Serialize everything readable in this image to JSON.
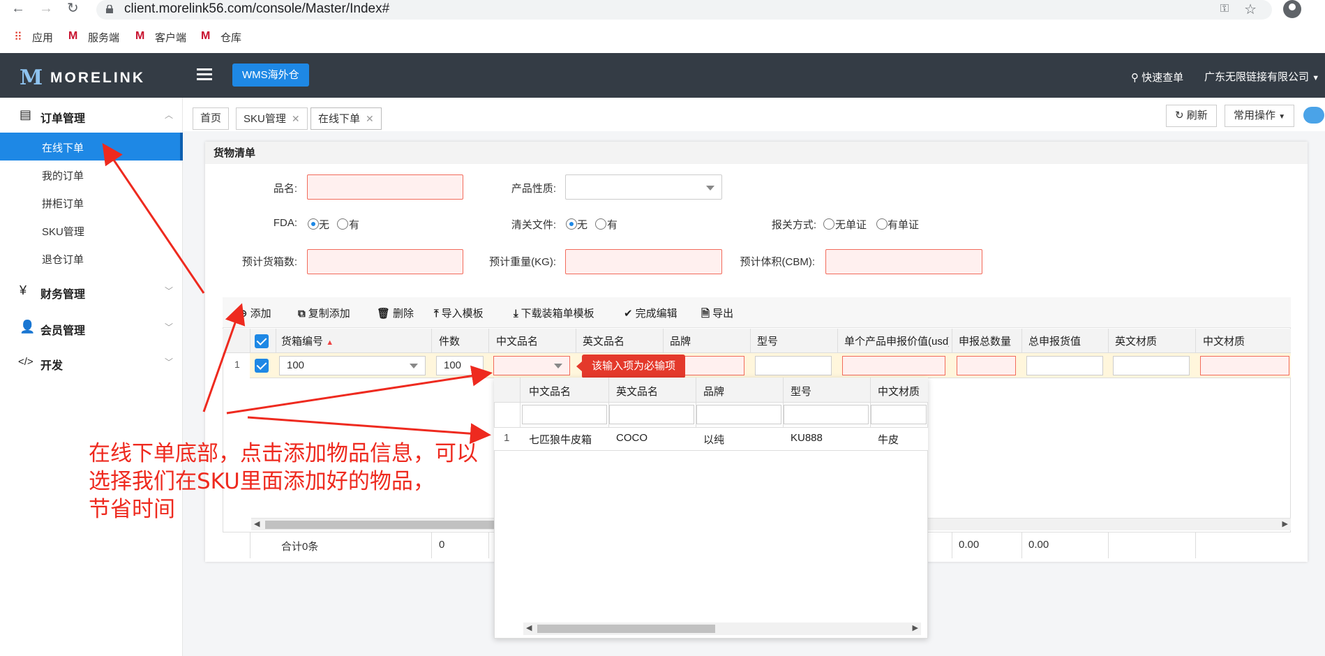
{
  "browser": {
    "url": "client.morelink56.com/console/Master/Index#",
    "bookmarks": {
      "apps": "应用",
      "server": "服务端",
      "client": "客户端",
      "warehouse": "仓库"
    }
  },
  "header": {
    "logo": "MORELINK",
    "logo_mark": "M",
    "wms_button": "WMS海外仓",
    "quick_search": "快速查单",
    "company": "广东无限链接有限公司"
  },
  "sidebar": {
    "groups": [
      {
        "label": "订单管理",
        "icon": "▤"
      },
      {
        "label": "财务管理",
        "icon": "¥"
      },
      {
        "label": "会员管理",
        "icon": "👤"
      },
      {
        "label": "开发",
        "icon": "</>"
      }
    ],
    "items": [
      "在线下单",
      "我的订单",
      "拼柜订单",
      "SKU管理",
      "退仓订单"
    ]
  },
  "tabs": [
    "首页",
    "SKU管理",
    "在线下单"
  ],
  "actions": {
    "refresh": "刷新",
    "common_ops": "常用操作"
  },
  "form": {
    "title": "货物清单",
    "name_label": "品名:",
    "nature_label": "产品性质:",
    "fda_label": "FDA:",
    "customs_docs_label": "清关文件:",
    "declare_label": "报关方式:",
    "opt_no": "无",
    "opt_yes": "有",
    "opt_no_doc": "无单证",
    "opt_has_doc": "有单证",
    "boxes_label": "预计货箱数:",
    "weight_label": "预计重量(KG):",
    "volume_label": "预计体积(CBM):"
  },
  "toolbar": {
    "add": "添加",
    "copy_add": "复制添加",
    "delete": "删除",
    "import_template": "导入模板",
    "download_template": "下载装箱单模板",
    "finish_edit": "完成编辑",
    "export": "导出"
  },
  "grid": {
    "columns": [
      "货箱编号",
      "件数",
      "中文品名",
      "英文品名",
      "品牌",
      "型号",
      "单个产品申报价值(usd)",
      "申报总数量",
      "总申报货值",
      "英文材质",
      "中文材质"
    ],
    "row": {
      "num": "1",
      "box_no": "100",
      "qty": "100"
    },
    "footer": {
      "total": "合计0条",
      "qty": "0",
      "declare_qty": "0.00",
      "declare_value": "0.00"
    },
    "tooltip": "该输入项为必输项"
  },
  "dropdown": {
    "columns": [
      "中文品名",
      "英文品名",
      "品牌",
      "型号",
      "中文材质"
    ],
    "row": {
      "num": "1",
      "cn_name": "七匹狼牛皮箱",
      "en_name": "COCO",
      "brand": "以纯",
      "model": "KU888",
      "material": "牛皮"
    }
  },
  "annotation": {
    "line1": "在线下单底部，点击添加物品信息，可以",
    "line2": "选择我们在SKU里面添加好的物品，",
    "line3": "节省时间",
    "color": "#ee2a1f"
  }
}
